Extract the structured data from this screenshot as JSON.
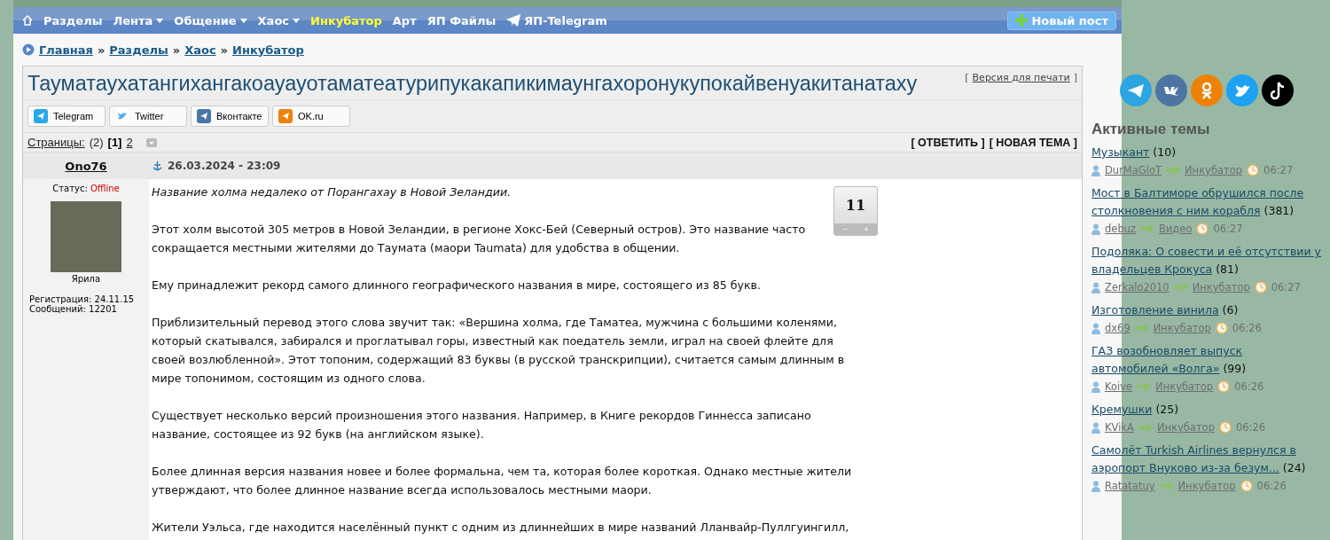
{
  "nav": {
    "items": [
      {
        "label": "Разделы",
        "dropdown": false,
        "selected": false,
        "kind": "text"
      },
      {
        "label": "Лента",
        "dropdown": true,
        "selected": false,
        "kind": "text"
      },
      {
        "label": "Общение",
        "dropdown": true,
        "selected": false,
        "kind": "text"
      },
      {
        "label": "Хаос",
        "dropdown": true,
        "selected": false,
        "kind": "text"
      },
      {
        "label": "Инкубатор",
        "dropdown": false,
        "selected": true,
        "kind": "text"
      },
      {
        "label": "Арт",
        "dropdown": false,
        "selected": false,
        "kind": "text"
      },
      {
        "label": "ЯП Файлы",
        "dropdown": false,
        "selected": false,
        "kind": "text"
      },
      {
        "label": "ЯП-Telegram",
        "dropdown": false,
        "selected": false,
        "kind": "telegram"
      }
    ],
    "new_post": "Новый пост"
  },
  "breadcrumbs": [
    "Главная",
    "Разделы",
    "Хаос",
    "Инкубатор"
  ],
  "breadcrumb_separator": "»",
  "topic": {
    "title": "Тауматаухатангихангакоауауотаматеатурипукакапикимаунгахоронукупокайвенуакитанатаху",
    "print_link": "Версия для печати",
    "brackets": [
      "[",
      "]"
    ]
  },
  "share": [
    {
      "label": "Telegram",
      "kind": "telegram"
    },
    {
      "label": "Twitter",
      "kind": "twitter"
    },
    {
      "label": "Вконтакте",
      "kind": "vk"
    },
    {
      "label": "OK.ru",
      "kind": "ok"
    }
  ],
  "pages": {
    "label": "Страницы:",
    "count": "(2)",
    "items": [
      {
        "label": "[1]",
        "selected": true
      },
      {
        "label": "2",
        "selected": false
      }
    ],
    "actions": [
      "[ ОТВЕТИТЬ ]",
      "[ НОВАЯ ТЕМА ]"
    ]
  },
  "post": {
    "author": "Ono76",
    "date": "26.03.2024 - 23:09",
    "status_label": "Статус:",
    "status": "Offline",
    "rank": "Ярила",
    "registration": "Регистрация: 24.11.15",
    "messages": "Сообщений: 12201",
    "rating": {
      "value": "11",
      "minus": "−",
      "plus": "+"
    },
    "paragraphs": [
      {
        "text": "Название холма недалеко от Порангахау в Новой Зеландии.",
        "italic": true
      },
      {
        "text": "Этот холм высотой 305 метров в Новой Зеландии, в регионе Хокс-Бей (Северный остров). Это название часто сокращается местными жителями до Таумата (маори Taumata) для удобства в общении.",
        "italic": false
      },
      {
        "text": "Ему принадлежит рекорд самого длинного географического названия в мире, состоящего из 85 букв.",
        "italic": false
      },
      {
        "text": "Приблизительный перевод этого слова звучит так: «Вершина холма, где Таматеа, мужчина с большими коленями, который скатывался, забирался и проглатывал горы, известный как поедатель земли, играл на своей флейте для своей возлюбленной». Этот топоним, содержащий 83 буквы (в русской транскрипции), считается самым длинным в мире топонимом, состоящим из одного слова.",
        "italic": false
      },
      {
        "text": "Существует несколько версий произношения этого названия. Например, в Книге рекордов Гиннесса записано название, состоящее из 92 букв (на английском языке).",
        "italic": false
      },
      {
        "text": "Более длинная версия названия новее и более формальна, чем та, которая более короткая. Однако местные жители утверждают, что более длинное название всегда использовалось местными маори.",
        "italic": false
      },
      {
        "text": "Жители Уэльса, где находится населённый пункт с одним из длиннейших в мире названий Лланвайр-Пуллгуингилл,",
        "italic": false
      }
    ]
  },
  "sidebar": {
    "social": [
      {
        "kind": "telegram",
        "color": "#2ca5e0"
      },
      {
        "kind": "vk",
        "color": "#4c75a3"
      },
      {
        "kind": "ok",
        "color": "#ee8208"
      },
      {
        "kind": "twitter",
        "color": "#1da1f2"
      },
      {
        "kind": "tiktok",
        "color": "#000000"
      }
    ],
    "heading": "Активные темы",
    "topics": [
      {
        "title": "Музыкант",
        "count": "(10)",
        "user": "DurMaGloT",
        "section": "Инкубатор",
        "time": "06:27"
      },
      {
        "title": "Мост в Балтиморе обрушился после столкновения с ним корабля",
        "count": "(381)",
        "user": "debuz",
        "section": "Видео",
        "time": "06:27"
      },
      {
        "title": "Подоляка: О совести и её отсутствии у владельцев Крокуса",
        "count": "(81)",
        "user": "Zerkalo2010",
        "section": "Инкубатор",
        "time": "06:27"
      },
      {
        "title": "Изготовление винила",
        "count": "(6)",
        "user": "dx69",
        "section": "Инкубатор",
        "time": "06:26"
      },
      {
        "title": "ГАЗ возобновляет выпуск автомобилей «Волга»",
        "count": "(99)",
        "user": "Koive",
        "section": "Инкубатор",
        "time": "06:26"
      },
      {
        "title": "Кремушки",
        "count": "(25)",
        "user": "KVikA",
        "section": "Инкубатор",
        "time": "06:26"
      },
      {
        "title": "Самолёт Turkish Airlines вернулся в аэропорт Внуково из-за безум...",
        "count": "(24)",
        "user": "Ratatatuy",
        "section": "Инкубатор",
        "time": "06:26"
      }
    ]
  }
}
